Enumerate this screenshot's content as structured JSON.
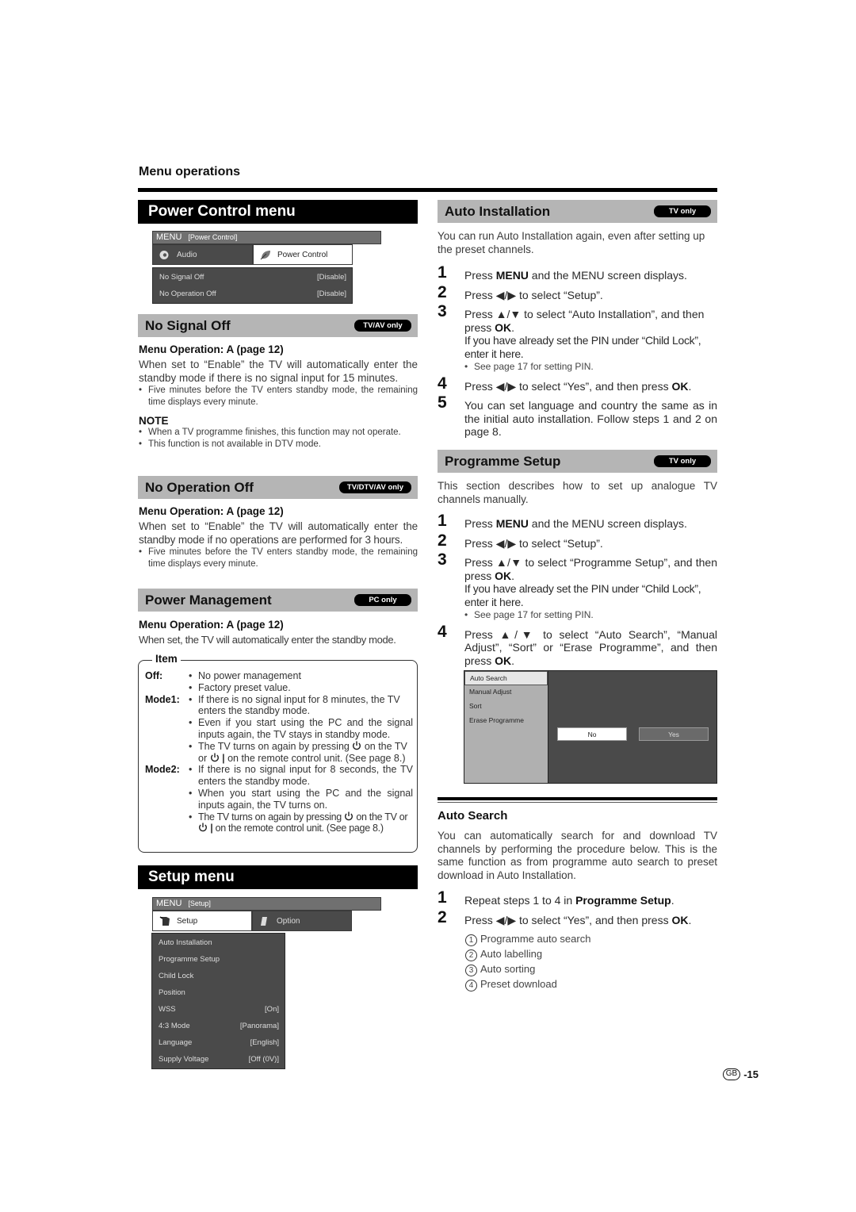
{
  "header": {
    "section_label": "Menu operations"
  },
  "left": {
    "power_control": {
      "title": "Power Control menu",
      "menu": {
        "bar_main": "MENU",
        "bar_sub": "[Power Control]",
        "tabs": [
          {
            "label": "Audio",
            "icon": "speaker-icon",
            "selected": false
          },
          {
            "label": "Power Control",
            "icon": "leaf-icon",
            "selected": true
          }
        ],
        "rows": [
          {
            "label": "No Signal Off",
            "value": "[Disable]"
          },
          {
            "label": "No Operation Off",
            "value": "[Disable]"
          }
        ]
      }
    },
    "no_signal_off": {
      "title": "No Signal Off",
      "badge": "TV/AV only",
      "subhead": "Menu Operation: A (page 12)",
      "text": "When set to “Enable” the TV will automatically enter the standby mode if there is no signal input for 15 minutes.",
      "bullet": "Five minutes before the TV enters standby mode, the remaining time displays every minute.",
      "note_label": "NOTE",
      "notes": [
        "When a TV programme finishes, this function may not operate.",
        "This function is not available in DTV mode."
      ]
    },
    "no_operation_off": {
      "title": "No Operation Off",
      "badge": "TV/DTV/AV only",
      "subhead": "Menu Operation: A (page 12)",
      "text": "When set to “Enable” the TV will automatically enter the standby mode if no operations are performed for 3 hours.",
      "bullet": "Five minutes before the TV enters standby mode, the remaining time displays every minute."
    },
    "power_management": {
      "title": "Power Management",
      "badge": "PC only",
      "subhead": "Menu Operation: A (page 12)",
      "text": "When set, the TV will automatically enter the standby mode.",
      "item_box": {
        "title": "Item",
        "off_key": "Off:",
        "off_bullets": [
          "No power management",
          "Factory preset value."
        ],
        "mode1_key": "Mode1:",
        "mode1_b1": "If there is no signal input for 8 minutes, the TV enters the standby mode.",
        "mode1_b2": "Even if you start using the PC and the signal inputs again, the TV stays in standby mode.",
        "mode1_b3_a": "The TV turns on again by pressing",
        "mode1_b3_b": "on the TV or",
        "mode1_b3_c": "on the remote control unit. (See page 8.)",
        "mode2_key": "Mode2:",
        "mode2_b1": "If there is no signal input for 8 seconds, the TV enters the standby mode.",
        "mode2_b2": "When you start using the PC and the signal inputs again, the TV turns on.",
        "mode2_b3_a": "The TV turns on again by pressing",
        "mode2_b3_b": "on the TV or",
        "mode2_b3_c": "on the remote control unit. (See page 8.)"
      }
    },
    "setup_menu": {
      "title": "Setup menu",
      "menu": {
        "bar_main": "MENU",
        "bar_sub": "[Setup]",
        "tabs": [
          {
            "label": "Setup",
            "icon": "setup-icon",
            "selected": true
          },
          {
            "label": "Option",
            "icon": "option-icon",
            "selected": false
          }
        ],
        "rows": [
          {
            "label": "Auto Installation",
            "value": ""
          },
          {
            "label": "Programme Setup",
            "value": ""
          },
          {
            "label": "Child Lock",
            "value": ""
          },
          {
            "label": "Position",
            "value": ""
          },
          {
            "label": "WSS",
            "value": "[On]"
          },
          {
            "label": "4:3 Mode",
            "value": "[Panorama]"
          },
          {
            "label": "Language",
            "value": "[English]"
          },
          {
            "label": "Supply Voltage",
            "value": "[Off (0V)]"
          }
        ]
      }
    }
  },
  "right": {
    "auto_installation": {
      "title": "Auto Installation",
      "badge": "TV only",
      "intro": "You can run Auto Installation again, even after setting up the preset channels.",
      "steps": {
        "s1_num": "1",
        "s1_a": "Press ",
        "s1_b": "MENU",
        "s1_c": " and the MENU screen displays.",
        "s2_num": "2",
        "s2_a": "Press ◀/▶ to select “Setup”.",
        "s3_num": "3",
        "s3_a": "Press ▲/▼ to select “Auto Installation”, and then press ",
        "s3_b": "OK",
        "s3_c": ".",
        "s3_d": "If you have already set the PIN under “Child Lock”, enter it here.",
        "s3_note": "See page 17 for setting PIN.",
        "s4_num": "4",
        "s4_a": "Press ◀/▶ to select “Yes”, and then press ",
        "s4_b": "OK",
        "s4_c": ".",
        "s5_num": "5",
        "s5_a": "You can set language and country the same as in the initial auto installation. Follow steps 1 and 2 on page 8."
      }
    },
    "programme_setup": {
      "title": "Programme Setup",
      "badge": "TV only",
      "intro": "This section describes how to set up analogue TV channels manually.",
      "steps": {
        "s1_num": "1",
        "s1_a": "Press ",
        "s1_b": "MENU",
        "s1_c": " and the MENU screen displays.",
        "s2_num": "2",
        "s2_a": "Press ◀/▶ to select “Setup”.",
        "s3_num": "3",
        "s3_a": "Press ▲/▼ to select “Programme Setup”, and then press ",
        "s3_b": "OK",
        "s3_c": ".",
        "s3_d": "If you have already set the PIN under “Child Lock”, enter it here.",
        "s3_note": "See page 17 for setting PIN.",
        "s4_num": "4",
        "s4_a": "Press ▲/▼ to select “Auto Search”, “Manual Adjust”, “Sort” or “Erase Programme”, and then press ",
        "s4_b": "OK",
        "s4_c": "."
      },
      "screen": {
        "items": [
          "Auto Search",
          "Manual Adjust",
          "Sort",
          "Erase Programme"
        ],
        "selected": "Auto Search",
        "no_label": "No",
        "yes_label": "Yes"
      }
    },
    "auto_search": {
      "title": "Auto Search",
      "intro": "You can automatically search for and download TV channels  by performing the procedure below. This is the same function as from programme auto search to preset download in Auto Installation.",
      "steps": {
        "s1_num": "1",
        "s1_a": "Repeat steps 1 to 4 in ",
        "s1_b": "Programme Setup",
        "s1_c": ".",
        "s2_num": "2",
        "s2_a": "Press ◀/▶ to select “Yes”, and then press ",
        "s2_b": "OK",
        "s2_c": "."
      },
      "sub_list": [
        {
          "n": "1",
          "text": "Programme auto search"
        },
        {
          "n": "2",
          "text": "Auto labelling"
        },
        {
          "n": "3",
          "text": "Auto sorting"
        },
        {
          "n": "4",
          "text": "Preset download"
        }
      ]
    }
  },
  "footer": {
    "region": "GB",
    "page": "-15"
  }
}
